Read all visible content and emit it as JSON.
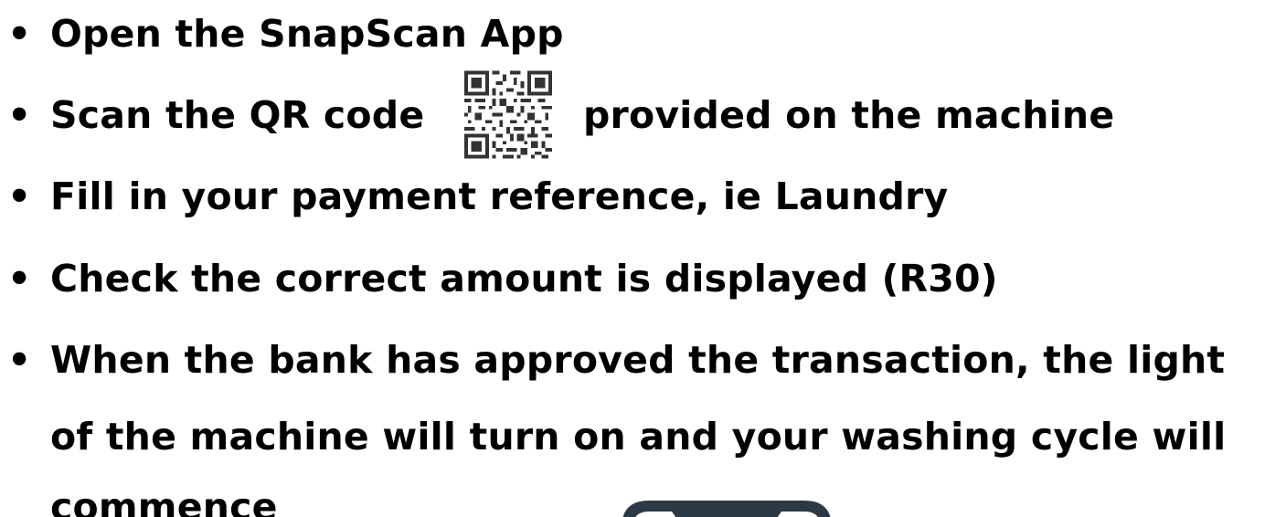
{
  "instructions": {
    "bullet_glyph": "•",
    "items": [
      {
        "text": "Open the SnapScan App"
      },
      {
        "text_before": "Scan the QR code",
        "icon": "qr-code-icon",
        "text_after": "provided on the machine"
      },
      {
        "text": "Fill in your payment reference, ie Laundry"
      },
      {
        "text": "Check the correct amount is displayed (R30)"
      },
      {
        "line1": "When the bank has approved the transaction, the light",
        "line2": "of the machine will turn on and your washing cycle will",
        "line3": "commence"
      }
    ]
  },
  "decorations": {
    "bottom_icon": "phone-icon",
    "bottom_icon_color": "#2b3a46"
  }
}
